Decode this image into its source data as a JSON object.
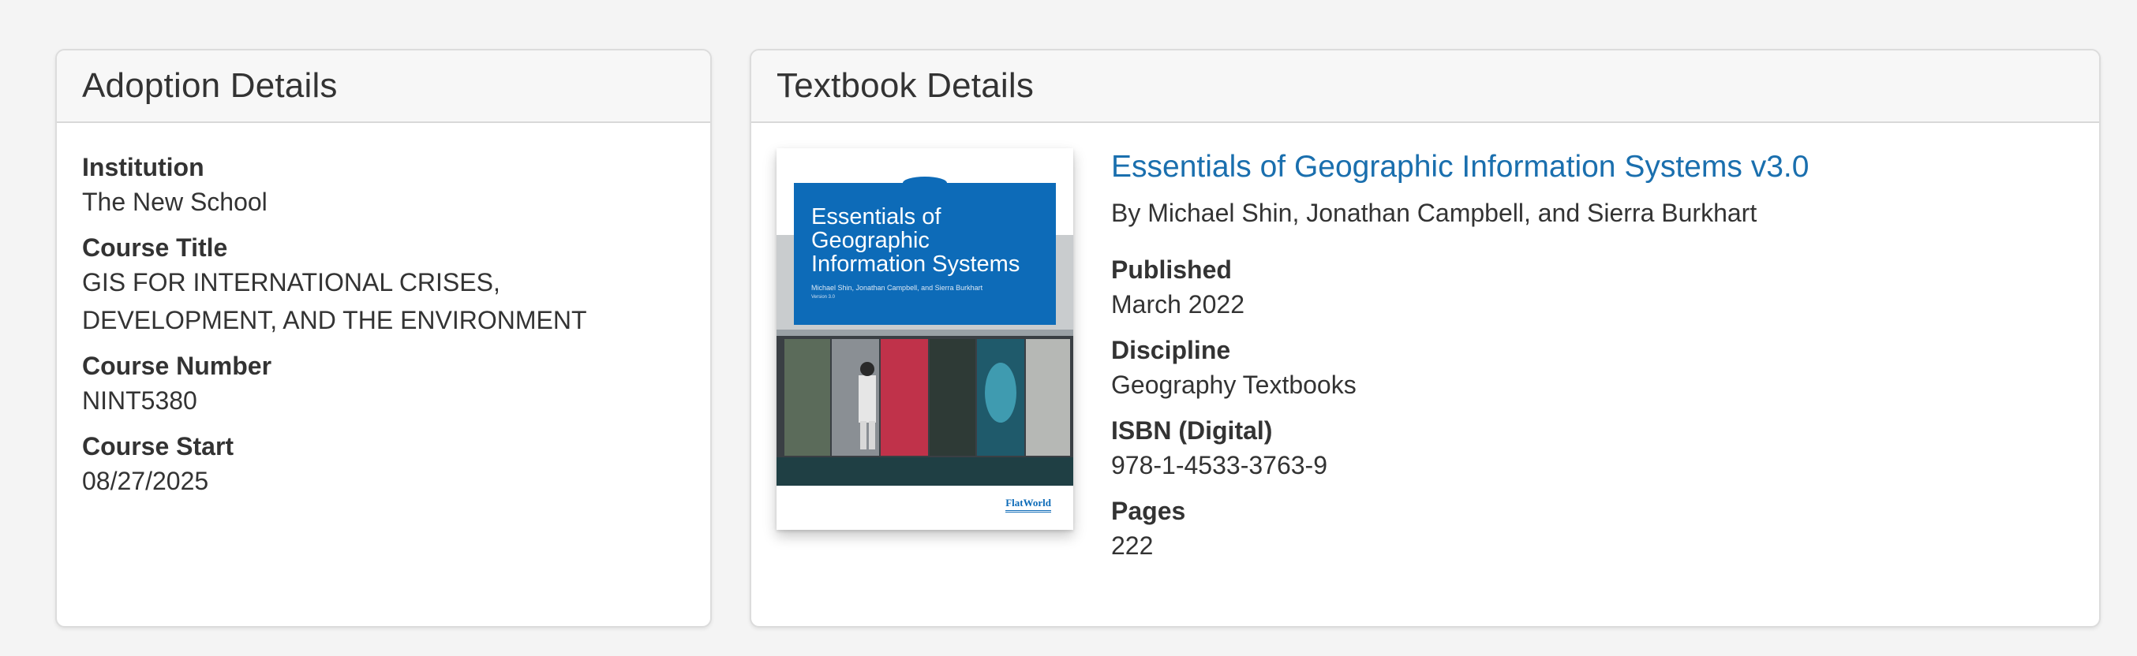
{
  "adoption": {
    "header": "Adoption Details",
    "fields": [
      {
        "label": "Institution",
        "value": "The New School"
      },
      {
        "label": "Course Title",
        "value": "GIS FOR INTERNATIONAL CRISES, DEVELOPMENT, AND THE ENVIRONMENT"
      },
      {
        "label": "Course Number",
        "value": "NINT5380"
      },
      {
        "label": "Course Start",
        "value": "08/27/2025"
      }
    ]
  },
  "textbook": {
    "header": "Textbook Details",
    "title": "Essentials of Geographic Information Systems v3.0",
    "authors": "By Michael Shin, Jonathan Campbell, and Sierra Burkhart",
    "fields": [
      {
        "label": "Published",
        "value": "March 2022"
      },
      {
        "label": "Discipline",
        "value": "Geography Textbooks"
      },
      {
        "label": "ISBN (Digital)",
        "value": "978-1-4533-3763-9"
      },
      {
        "label": "Pages",
        "value": "222"
      }
    ],
    "cover": {
      "title": "Essentials of Geographic Information Systems",
      "authors": "Michael Shin, Jonathan Campbell, and Sierra Burkhart",
      "version": "Version 3.0",
      "publisher": "FlatWorld"
    }
  },
  "colors": {
    "link": "#1a6fae",
    "cover_blue": "#0d6bb8",
    "background": "#f4f4f4"
  }
}
